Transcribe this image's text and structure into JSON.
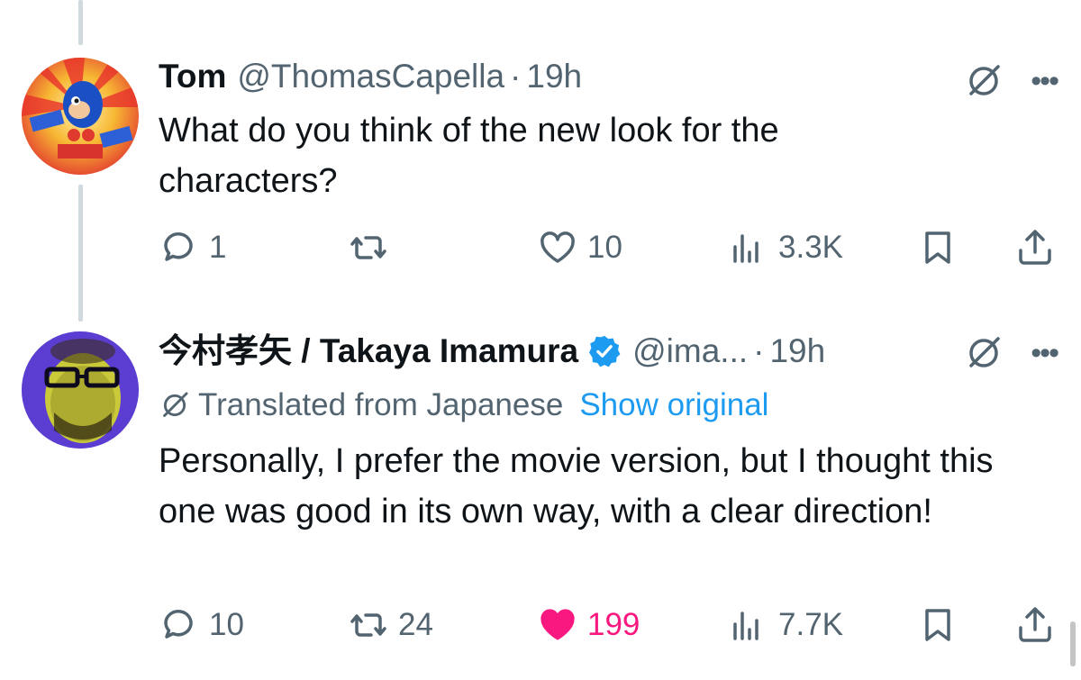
{
  "tweets": [
    {
      "display_name": "Tom",
      "handle": "@ThomasCapella",
      "separator": "·",
      "time": "19h",
      "text": "What do you think of the new look for the characters?",
      "actions": {
        "replies": "1",
        "reposts": "",
        "likes": "10",
        "views": "3.3K"
      },
      "liked": false
    },
    {
      "display_name": "今村孝矢 / Takaya Imamura",
      "verified": true,
      "handle": "@ima...",
      "separator": "·",
      "time": "19h",
      "translated_label": "Translated from Japanese",
      "show_original_label": "Show original",
      "text": "Personally, I prefer the movie version, but I thought this one was good in its own way, with a clear direction!",
      "actions": {
        "replies": "10",
        "reposts": "24",
        "likes": "199",
        "views": "7.7K"
      },
      "liked": true
    }
  ],
  "icons": {
    "reply": "speech-bubble-icon",
    "repost": "repost-arrows-icon",
    "like": "heart-icon",
    "views": "bar-chart-icon",
    "bookmark": "bookmark-icon",
    "share": "share-upload-icon",
    "grok": "grok-slash-icon",
    "more": "more-dots-icon",
    "verified": "verified-badge-icon"
  },
  "colors": {
    "text": "#0f1419",
    "muted": "#536471",
    "link": "#1d9bf0",
    "like_active": "#f91880",
    "thread_line": "#cfd9de"
  }
}
